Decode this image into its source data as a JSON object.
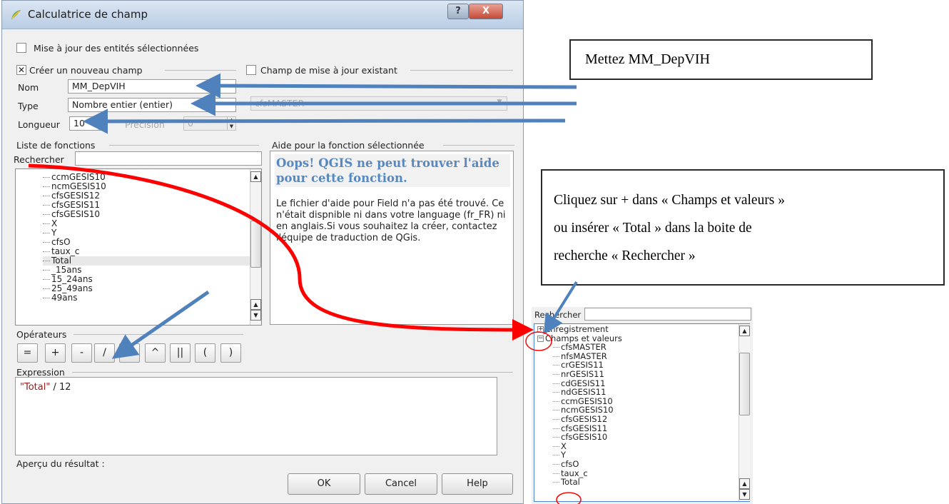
{
  "dialog": {
    "title": "Calculatrice de champ",
    "update_selected_label": "Mise à jour des entités sélectionnées",
    "create_field_label": "Créer un nouveau champ",
    "update_existing_label": "Champ de mise à jour existant",
    "name_label": "Nom",
    "name_value": "MM_DepVIH",
    "type_label": "Type",
    "type_value": "Nombre entier (entier)",
    "existing_field_value": "cfsMASTER",
    "length_label": "Longueur",
    "length_value": "10",
    "precision_label": "Précision",
    "precision_value": "0",
    "functions_label": "Liste de fonctions",
    "search_label": "Rechercher",
    "help_section_label": "Aide pour la fonction sélectionnée",
    "function_items": [
      "ccmGESIS10",
      "ncmGESIS10",
      "cfsGESIS12",
      "cfsGESIS11",
      "cfsGESIS10",
      "X",
      "Y",
      "cfsO",
      "taux_c",
      "Total",
      "_15ans",
      "15_24ans",
      "25_49ans",
      "49ans"
    ],
    "help_title": "Oops! QGIS ne peut trouver l'aide pour cette fonction.",
    "help_body": "Le fichier d'aide pour Field n'a pas été trouvé. Ce n'était dispnible ni dans votre language (fr_FR) ni en anglais.Si vous souhaitez la créer, contactez l'équipe de traduction de QGis.",
    "operators_label": "Opérateurs",
    "operators": [
      "=",
      "+",
      "-",
      "/",
      "*",
      "^",
      "||",
      "(",
      ")"
    ],
    "expression_label": "Expression",
    "expression_field": "\"Total\"",
    "expression_rest": " / 12",
    "preview_label": "Aperçu du résultat :",
    "ok_label": "OK",
    "cancel_label": "Cancel",
    "help_label": "Help"
  },
  "callouts": {
    "name_hint": "Mettez MM_DepVIH",
    "total_hint_lines": [
      "Cliquez sur + dans « Champs et valeurs »",
      "ou insérer « Total » dans la boite de",
      "recherche « Rechercher »"
    ]
  },
  "zoom": {
    "search_label": "Rechercher",
    "group_record": "Enregistrement",
    "group_fields": "Champs et valeurs",
    "items": [
      "cfsMASTER",
      "nfsMASTER",
      "crGESIS11",
      "nrGESIS11",
      "cdGESIS11",
      "ndGESIS11",
      "ccmGESIS10",
      "ncmGESIS10",
      "cfsGESIS12",
      "cfsGESIS11",
      "cfsGESIS10",
      "X",
      "Y",
      "cfsO",
      "taux_c",
      "Total"
    ]
  },
  "colors": {
    "arrow_blue": "#4f81bd",
    "curve_red": "#ff0000",
    "help_title_blue": "#5888c0",
    "field_name_red": "#9b1c1c"
  },
  "icons": [
    "qgis-logo-icon",
    "help-icon",
    "close-icon",
    "checkbox-checked-icon",
    "checkbox-unchecked-icon",
    "spin-up-icon",
    "spin-down-icon",
    "scroll-up-icon",
    "scroll-down-icon",
    "tree-collapse-icon",
    "tree-expand-icon"
  ]
}
